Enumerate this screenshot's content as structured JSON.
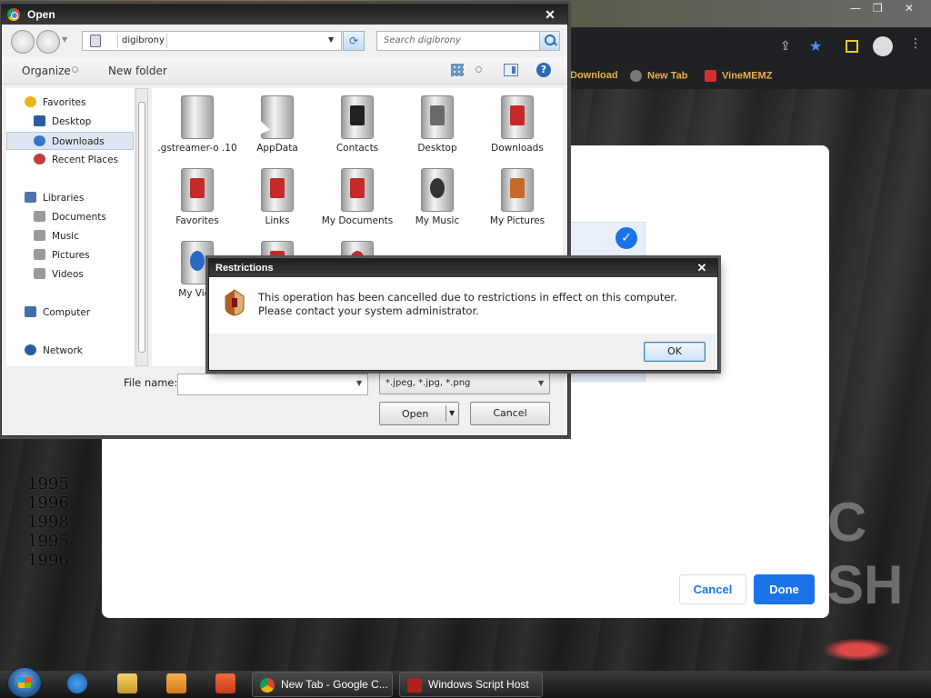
{
  "browser": {
    "bookmarks": [
      {
        "label": "Download",
        "icon": "download-bookmark-icon",
        "color": "#e8b04a"
      },
      {
        "label": "New Tab",
        "icon": "globe-icon",
        "color": "#888888"
      },
      {
        "label": "VineMEMZ",
        "icon": "vinememz-icon",
        "color": "#d32f2f"
      }
    ],
    "years": [
      "1995",
      "1996",
      "1998",
      "1995",
      "1996"
    ],
    "bg_letters": "C SH"
  },
  "web_dialog": {
    "cancel_label": "Cancel",
    "done_label": "Done",
    "accent": "#1a73e8"
  },
  "open_dialog": {
    "title": "Open",
    "close_glyph": "✕",
    "address": "digibrony",
    "search_placeholder": "Search digibrony",
    "organize_label": "Organize",
    "new_folder_label": "New folder",
    "help_glyph": "?",
    "sidebar": [
      {
        "label": "Favorites",
        "icon": "favorites-star-icon",
        "group": true
      },
      {
        "label": "Desktop",
        "icon": "desktop-icon"
      },
      {
        "label": "Downloads",
        "icon": "downloads-icon",
        "selected": true
      },
      {
        "label": "Recent Places",
        "icon": "recent-places-icon"
      },
      {
        "label": "Libraries",
        "icon": "libraries-icon",
        "group": true
      },
      {
        "label": "Documents",
        "icon": "documents-icon"
      },
      {
        "label": "Music",
        "icon": "music-icon"
      },
      {
        "label": "Pictures",
        "icon": "pictures-icon"
      },
      {
        "label": "Videos",
        "icon": "videos-icon"
      },
      {
        "label": "Computer",
        "icon": "computer-icon",
        "group": true
      },
      {
        "label": "Network",
        "icon": "network-icon",
        "group": true
      }
    ],
    "files": [
      {
        "label": ".gstreamer-o .10",
        "icon": "folder-icon"
      },
      {
        "label": "AppData",
        "icon": "folder-icon"
      },
      {
        "label": "Contacts",
        "icon": "contacts-folder-icon"
      },
      {
        "label": "Desktop",
        "icon": "desktop-folder-icon"
      },
      {
        "label": "Downloads",
        "icon": "downloads-folder-icon"
      },
      {
        "label": "Favorites",
        "icon": "favorites-folder-icon"
      },
      {
        "label": "Links",
        "icon": "links-folder-icon"
      },
      {
        "label": "My Documents",
        "icon": "my-documents-folder-icon"
      },
      {
        "label": "My Music",
        "icon": "my-music-folder-icon"
      },
      {
        "label": "My Pictures",
        "icon": "my-pictures-folder-icon"
      },
      {
        "label": "My Vide",
        "icon": "my-videos-folder-icon"
      },
      {
        "label": "",
        "icon": "folder-icon"
      },
      {
        "label": "",
        "icon": "folder-icon"
      }
    ],
    "filename_label": "File name:",
    "filename_value": "",
    "filter_value": "*.jpeg, *.jpg, *.png",
    "open_label": "Open",
    "cancel_label": "Cancel"
  },
  "restrictions": {
    "title": "Restrictions",
    "close_glyph": "✕",
    "message": "This operation has been cancelled due to restrictions in effect on this computer. Please contact your system administrator.",
    "ok_label": "OK"
  },
  "taskbar": {
    "tasks": [
      {
        "label": "New Tab - Google C...",
        "icon": "chrome-icon"
      },
      {
        "label": "Windows Script Host",
        "icon": "script-host-icon"
      }
    ]
  }
}
